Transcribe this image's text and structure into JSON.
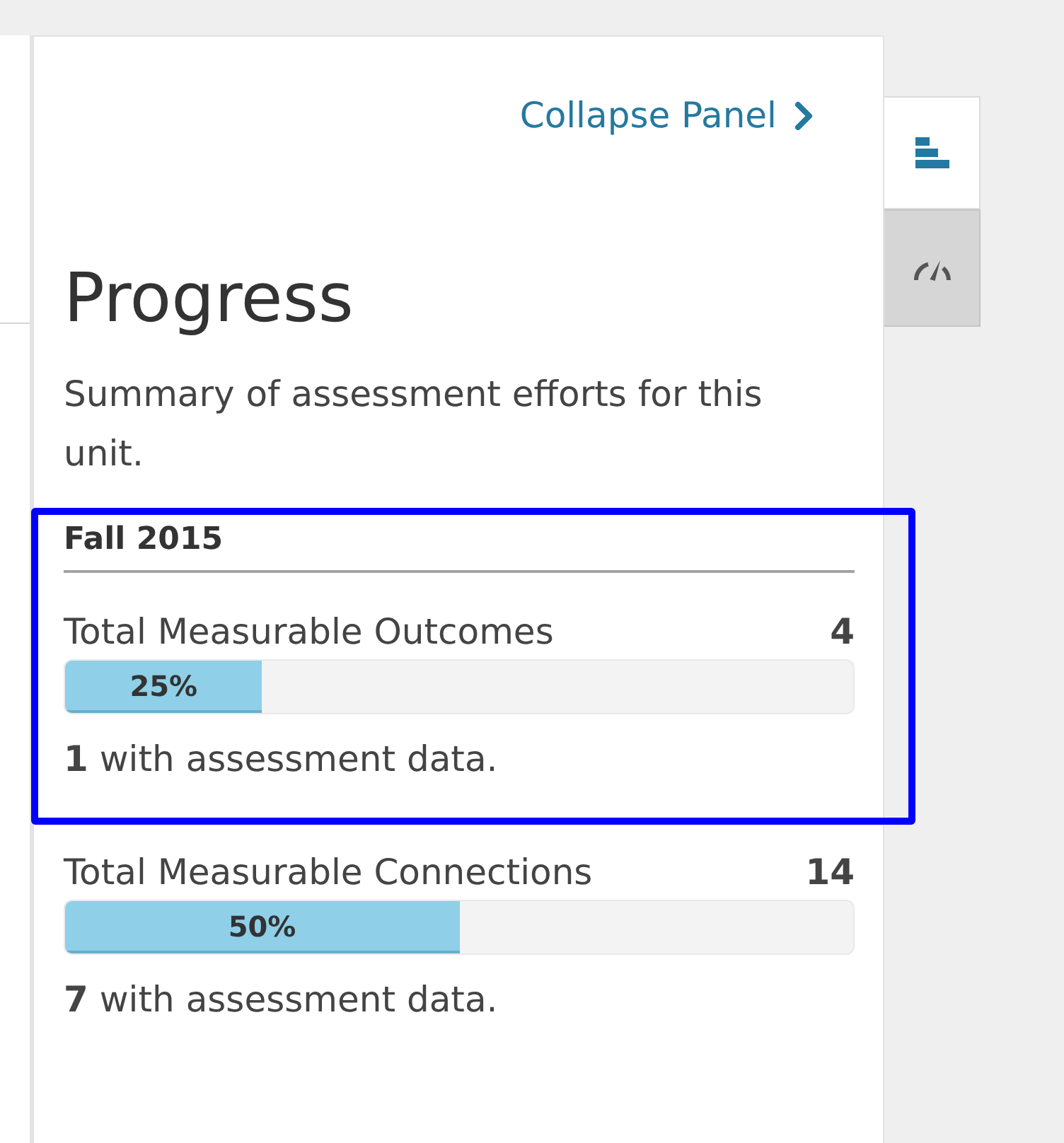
{
  "panel": {
    "collapse_link": "Collapse Panel",
    "title": "Progress",
    "description": "Summary of assessment efforts for this unit."
  },
  "sections": [
    {
      "kind": "term_heading",
      "title": "Fall 2015",
      "highlighted": true
    },
    {
      "kind": "metric",
      "label": "Total Measurable Outcomes",
      "total": "4",
      "level": 0.25,
      "percent": "25%",
      "caption": "**1** with assessment data.",
      "highlighted": true
    },
    {
      "kind": "metric",
      "label": "Total Measurable Connections",
      "total": "14",
      "level": 0.5,
      "percent": "50%",
      "caption": "**7** with assessment data.",
      "highlighted": false
    }
  ],
  "side_tabs": [
    {
      "kind": "bars",
      "selected": true
    },
    {
      "kind": "gauge",
      "selected": false
    }
  ]
}
